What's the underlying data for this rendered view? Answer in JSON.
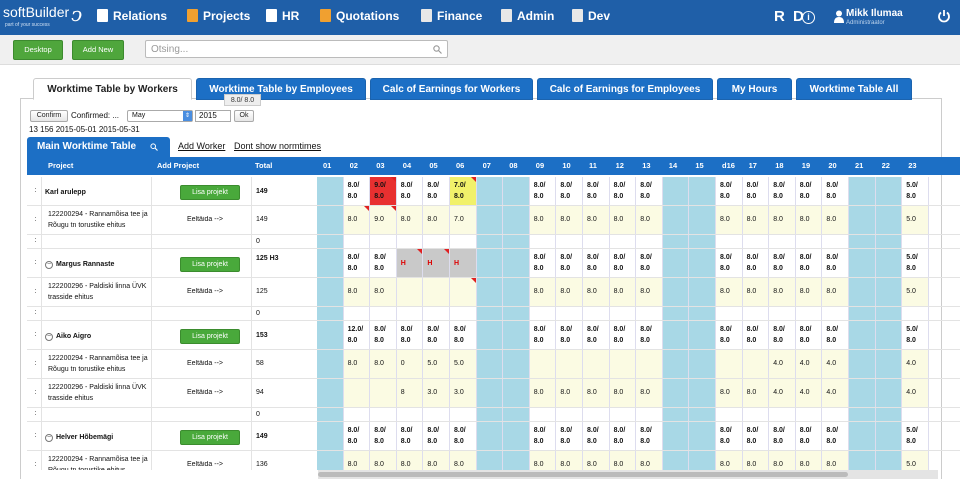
{
  "app": {
    "logo_text": "softBuilder",
    "logo_tagline": "part of your success",
    "logo_mark": "ↄ"
  },
  "nav": [
    {
      "label": "Relations",
      "icon": "people-icon"
    },
    {
      "label": "Projects",
      "icon": "folder-icon"
    },
    {
      "label": "HR",
      "icon": "person-icon"
    },
    {
      "label": "Quotations",
      "icon": "folder-icon"
    },
    {
      "label": "Finance",
      "icon": "document-icon"
    },
    {
      "label": "Admin",
      "icon": "admin-icon"
    },
    {
      "label": "Dev",
      "icon": "admin-icon"
    }
  ],
  "user": {
    "initials": "R D",
    "name": "Mikk Ilumaa",
    "role": "Administraator"
  },
  "toolbar": {
    "desktop_label": "Desktop",
    "add_new_label": "Add New",
    "search_placeholder": "Otsing..."
  },
  "tabs": [
    {
      "label": "Worktime Table by Workers",
      "active": true
    },
    {
      "label": "Worktime Table by Employees",
      "active": false
    },
    {
      "label": "Calc of Earnings for Workers",
      "active": false
    },
    {
      "label": "Calc of Earnings for Employees",
      "active": false
    },
    {
      "label": "My Hours",
      "active": false
    },
    {
      "label": "Worktime Table All",
      "active": false
    }
  ],
  "tooltip": "8.0/ 8.0",
  "filters": {
    "confirm_label": "Confirm",
    "confirmed_label": "Confirmed: ...",
    "month": "May",
    "year": "2015",
    "ok_label": "Ok",
    "summary": "13 156 2015-05-01 2015-05-31"
  },
  "section": {
    "main_tab": "Main Worktime Table",
    "add_worker": "Add Worker",
    "dont_show": "Dont show normtimes"
  },
  "table": {
    "headers": [
      "Project",
      "Add Project",
      "Total"
    ],
    "days": [
      "01",
      "02",
      "03",
      "04",
      "05",
      "06",
      "07",
      "08",
      "09",
      "10",
      "11",
      "12",
      "13",
      "14",
      "15",
      "d16",
      "17",
      "18",
      "19",
      "20",
      "21",
      "22",
      "23"
    ],
    "add_project_label": "Lisa projekt",
    "eeltaida_label": "Eeltäida -->",
    "rows": [
      {
        "kind": "worker",
        "name": "Karl arulepp",
        "collapsible": false,
        "total": "149",
        "cells": [
          "",
          "8.0/ 8.0",
          "9.0/ 8.0",
          "8.0/ 8.0",
          "8.0/ 8.0",
          "7.0/ 8.0",
          "",
          "",
          "8.0/ 8.0",
          "8.0/ 8.0",
          "8.0/ 8.0",
          "8.0/ 8.0",
          "8.0/ 8.0",
          "",
          "",
          "8.0/ 8.0",
          "8.0/ 8.0",
          "8.0/ 8.0",
          "8.0/ 8.0",
          "8.0/ 8.0",
          "",
          "",
          "5.0/ 8.0"
        ]
      },
      {
        "kind": "project",
        "name": "122200294 - Rannamõisa tee ja Rõugu tn torustike ehitus",
        "total": "149",
        "cells": [
          "",
          "8.0",
          "9.0",
          "8.0",
          "8.0",
          "7.0",
          "",
          "",
          "8.0",
          "8.0",
          "8.0",
          "8.0",
          "8.0",
          "",
          "",
          "8.0",
          "8.0",
          "8.0",
          "8.0",
          "8.0",
          "",
          "",
          "5.0"
        ]
      },
      {
        "kind": "empty",
        "total": "0"
      },
      {
        "kind": "worker",
        "name": "Margus Rannaste",
        "collapsible": true,
        "total": "125 H3",
        "cells": [
          "",
          "8.0/ 8.0",
          "8.0/ 8.0",
          "H",
          "H",
          "H",
          "",
          "",
          "8.0/ 8.0",
          "8.0/ 8.0",
          "8.0/ 8.0",
          "8.0/ 8.0",
          "8.0/ 8.0",
          "",
          "",
          "8.0/ 8.0",
          "8.0/ 8.0",
          "8.0/ 8.0",
          "8.0/ 8.0",
          "8.0/ 8.0",
          "",
          "",
          "5.0/ 8.0"
        ]
      },
      {
        "kind": "project",
        "name": "122200296 - Paldiski linna ÜVK trasside ehitus",
        "total": "125",
        "cells": [
          "",
          "8.0",
          "8.0",
          "",
          "",
          "",
          "",
          "",
          "8.0",
          "8.0",
          "8.0",
          "8.0",
          "8.0",
          "",
          "",
          "8.0",
          "8.0",
          "8.0",
          "8.0",
          "8.0",
          "",
          "",
          "5.0"
        ]
      },
      {
        "kind": "empty",
        "total": "0"
      },
      {
        "kind": "worker",
        "name": "Aiko Aigro",
        "collapsible": true,
        "total": "153",
        "cells": [
          "",
          "12.0/ 8.0",
          "8.0/ 8.0",
          "8.0/ 8.0",
          "8.0/ 8.0",
          "8.0/ 8.0",
          "",
          "",
          "8.0/ 8.0",
          "8.0/ 8.0",
          "8.0/ 8.0",
          "8.0/ 8.0",
          "8.0/ 8.0",
          "",
          "",
          "8.0/ 8.0",
          "8.0/ 8.0",
          "8.0/ 8.0",
          "8.0/ 8.0",
          "8.0/ 8.0",
          "",
          "",
          "5.0/ 8.0"
        ]
      },
      {
        "kind": "project",
        "name": "122200294 - Rannamõisa tee ja Rõugu tn torustike ehitus",
        "total": "58",
        "cells": [
          "",
          "8.0",
          "8.0",
          "0",
          "5.0",
          "5.0",
          "",
          "",
          "",
          "",
          "",
          "",
          "",
          "",
          "",
          "",
          "",
          "4.0",
          "4.0",
          "4.0",
          "",
          "",
          "4.0"
        ]
      },
      {
        "kind": "project",
        "name": "122200296 - Paldiski linna ÜVK trasside ehitus",
        "total": "94",
        "cells": [
          "",
          "",
          "",
          "8",
          "3.0",
          "3.0",
          "",
          "",
          "8.0",
          "8.0",
          "8.0",
          "8.0",
          "8.0",
          "",
          "",
          "8.0",
          "8.0",
          "4.0",
          "4.0",
          "4.0",
          "",
          "",
          "4.0"
        ]
      },
      {
        "kind": "empty",
        "total": "0"
      },
      {
        "kind": "worker",
        "name": "Helver Hõbemägi",
        "collapsible": true,
        "total": "149",
        "cells": [
          "",
          "8.0/ 8.0",
          "8.0/ 8.0",
          "8.0/ 8.0",
          "8.0/ 8.0",
          "8.0/ 8.0",
          "",
          "",
          "8.0/ 8.0",
          "8.0/ 8.0",
          "8.0/ 8.0",
          "8.0/ 8.0",
          "8.0/ 8.0",
          "",
          "",
          "8.0/ 8.0",
          "8.0/ 8.0",
          "8.0/ 8.0",
          "8.0/ 8.0",
          "8.0/ 8.0",
          "",
          "",
          "5.0/ 8.0"
        ]
      },
      {
        "kind": "project",
        "name": "122200294 - Rannamõisa tee ja Rõugu tn torustike ehitus",
        "total": "136",
        "cells": [
          "",
          "8.0",
          "8.0",
          "8.0",
          "8.0",
          "8.0",
          "",
          "",
          "8.0",
          "8.0",
          "8.0",
          "8.0",
          "8.0",
          "",
          "",
          "8.0",
          "8.0",
          "8.0",
          "8.0",
          "8.0",
          "",
          "",
          "5.0"
        ]
      }
    ]
  },
  "colors": {
    "nav_bg": "#1f5fa8",
    "tab_blue": "#1c6fc5",
    "green": "#4fa63c",
    "weekend": "#a8d8e6",
    "project_row": "#fbfbe3",
    "overtime": "#e83030",
    "under": "#f1f16a",
    "holiday": "#c9c9c9",
    "flag": "#e02020"
  }
}
